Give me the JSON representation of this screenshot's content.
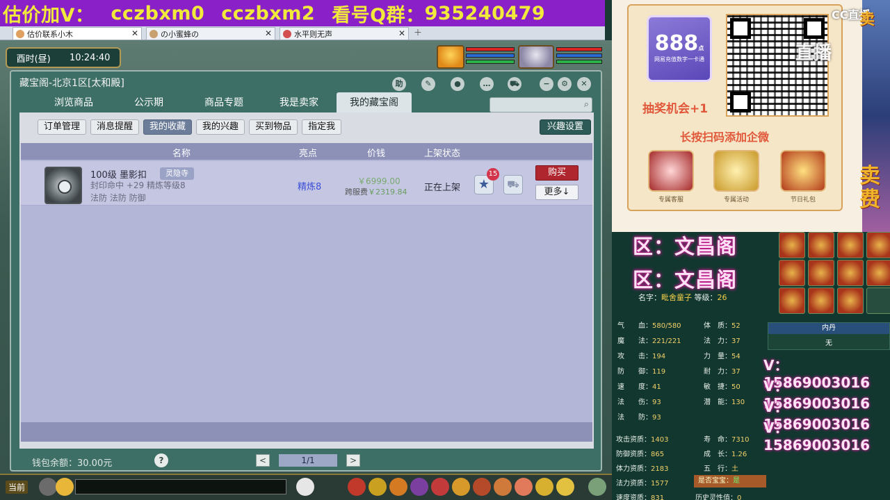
{
  "banner": {
    "part1": "估价加V：",
    "part2": "cczbxm0",
    "part3": "cczbxm2",
    "part4": "看号Q群：",
    "part5": "935240479"
  },
  "browser_tabs": [
    {
      "label": "估价联系小木",
      "active": true
    },
    {
      "label": "の小蜜蜂の",
      "active": false
    },
    {
      "label": "水平则无声",
      "active": false
    }
  ],
  "game": {
    "clock_period": "酉时(昼)",
    "clock_time": "10:24:40"
  },
  "dialog": {
    "title": "藏宝阁-北京1区[太和殿]",
    "help_icon": "助",
    "nav_tabs": [
      "浏览商品",
      "公示期",
      "商品专题",
      "我是卖家",
      "我的藏宝阁"
    ],
    "active_nav": 4,
    "search_placeholder": "",
    "subtabs": [
      "订单管理",
      "消息提醒",
      "我的收藏",
      "我的兴趣",
      "买到物品",
      "指定我"
    ],
    "active_subtab": 2,
    "interest_button": "兴趣设置",
    "columns": {
      "name": "名称",
      "highlight": "亮点",
      "price": "价钱",
      "status": "上架状态"
    },
    "item": {
      "name": "100级 墨影扣",
      "tag": "灵隐寺",
      "desc": "封印命中 +29 精炼等级8",
      "attrs": "法防 法防 防御",
      "highlight": "精炼8",
      "price": "￥6999.00",
      "fee_label": "跨服费",
      "fee": "￥2319.84",
      "status": "正在上架",
      "fav_count": "15",
      "buy": "购买",
      "more": "更多↓"
    },
    "footer": {
      "wallet": "钱包余额：30.00元",
      "help": "?",
      "prev": "<",
      "page": "1/1",
      "next": ">"
    }
  },
  "bottombar": {
    "channel": "当前"
  },
  "promo": {
    "prize_top": "888",
    "prize_unit": "点",
    "prize_sub": "网易充值数字一卡通",
    "lottery": "抽奖机会+1",
    "scan": "长按扫码添加企微",
    "perks": [
      "专属客服",
      "专属活动",
      "节日礼包"
    ],
    "cc": "CC直播",
    "cc2": "直播",
    "vert1": "卖",
    "vert2": "费",
    "vert3": "卖"
  },
  "character": {
    "pink1": "区：文昌阁",
    "pink2": "区：文昌阁",
    "name_label": "名字：",
    "name": "毗舍童子",
    "level_label": "等级：",
    "level": "26",
    "stats_left": [
      {
        "k": "气　　血：",
        "v": "580/580"
      },
      {
        "k": "魔　　法：",
        "v": "221/221"
      },
      {
        "k": "攻　　击：",
        "v": "194"
      },
      {
        "k": "防　　御：",
        "v": "119"
      },
      {
        "k": "速　　度：",
        "v": "41"
      },
      {
        "k": "法　　伤：",
        "v": "93"
      },
      {
        "k": "法　　防：",
        "v": "93"
      }
    ],
    "stats_mid": [
      {
        "k": "体　质：",
        "v": "52"
      },
      {
        "k": "法　力：",
        "v": "37"
      },
      {
        "k": "力　量：",
        "v": "54"
      },
      {
        "k": "耐　力：",
        "v": "37"
      },
      {
        "k": "敏　捷：",
        "v": "50"
      },
      {
        "k": "潜　能：",
        "v": "130"
      }
    ],
    "stats_bottom_left": [
      {
        "k": "攻击资质：",
        "v": "1403"
      },
      {
        "k": "防御资质：",
        "v": "865"
      },
      {
        "k": "体力资质：",
        "v": "2183"
      },
      {
        "k": "法力资质：",
        "v": "1577"
      },
      {
        "k": "速度资质：",
        "v": "831"
      }
    ],
    "stats_bottom_mid": [
      {
        "k": "寿　命：",
        "v": "7310"
      },
      {
        "k": "成　长：",
        "v": "1.26"
      },
      {
        "k": "五　行：",
        "v": "土"
      }
    ],
    "history_label": "历史灵性值：",
    "history": "0",
    "baobao_label": "是否宝宝：",
    "baobao": "是",
    "neidan_title": "内丹",
    "neidan_value": "无",
    "vnums": [
      "V：15869003016",
      "V：15869003016",
      "V：15869003016",
      "V：15869003016"
    ]
  }
}
